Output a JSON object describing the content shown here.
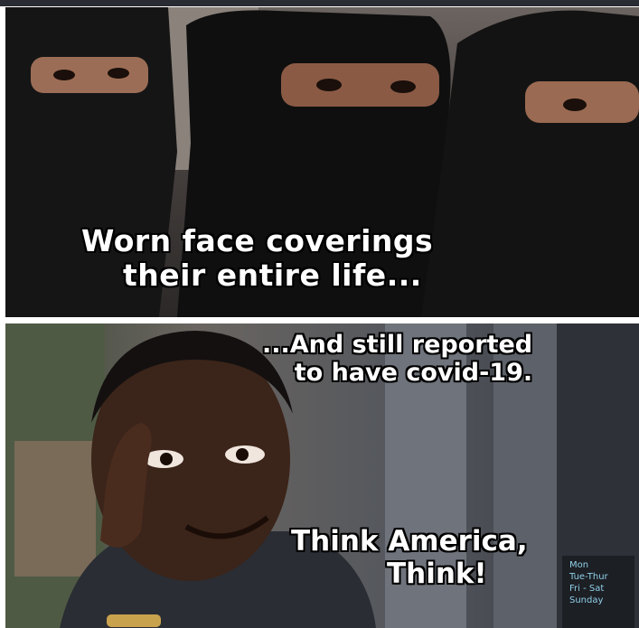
{
  "top_caption": {
    "line1": "Worn face coverings",
    "line2": "their entire life..."
  },
  "bottom_caption_top": {
    "line1": "...And still reported",
    "line2": "to have covid-19."
  },
  "bottom_caption_bottom": {
    "line1": "Think America,",
    "line2": "Think!"
  },
  "chalkboard_sign": {
    "lines": [
      "Mon",
      "Tue-Thur",
      "Fri - Sat",
      "Sunday"
    ]
  },
  "colors": {
    "caption_text": "#ffffff",
    "caption_outline": "#000000",
    "veil": "#121212",
    "skin_dark": "#3b2419",
    "skin_medium": "#8a5a45"
  }
}
